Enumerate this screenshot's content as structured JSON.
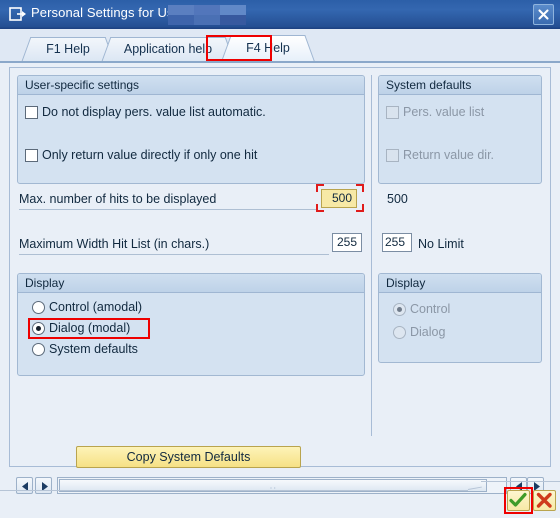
{
  "window": {
    "title": "Personal Settings for User",
    "title_icon": "dialog-window-icon",
    "username_redacted": "",
    "close_icon": "close-icon"
  },
  "tabs": [
    {
      "label": "F1 Help",
      "active": false
    },
    {
      "label": "Application help",
      "active": false
    },
    {
      "label": "F4 Help",
      "active": true,
      "highlighted": true
    }
  ],
  "user_settings": {
    "group_title": "User-specific settings",
    "checkboxes": [
      {
        "label": "Do not display pers. value list automatic.",
        "checked": false
      },
      {
        "label": "Only return value directly if only one hit",
        "checked": false
      }
    ],
    "fields": [
      {
        "label": "Max. number of hits to be displayed",
        "value": "500",
        "focused": true
      },
      {
        "label": "Maximum Width Hit List (in chars.)",
        "value": "255",
        "focused": false
      }
    ],
    "display_group": {
      "title": "Display",
      "options": [
        {
          "label": "Control (amodal)",
          "selected": false,
          "highlighted": false
        },
        {
          "label": "Dialog (modal)",
          "selected": true,
          "highlighted": true
        },
        {
          "label": "System defaults",
          "selected": false,
          "highlighted": false
        }
      ]
    }
  },
  "system_defaults": {
    "group_title": "System defaults",
    "checkboxes": [
      {
        "label": "Pers. value list",
        "checked": false,
        "disabled": true
      },
      {
        "label": "Return value dir.",
        "checked": false,
        "disabled": true
      }
    ],
    "max_hits_value": "500",
    "width_value": "255",
    "width_note": "No Limit",
    "display_group": {
      "title": "Display",
      "options": [
        {
          "label": "Control",
          "selected": true,
          "disabled": true
        },
        {
          "label": "Dialog",
          "selected": false,
          "disabled": true
        }
      ]
    }
  },
  "actions": {
    "copy_defaults_label": "Copy System Defaults",
    "ok_icon": "check-icon",
    "cancel_icon": "cross-icon",
    "ok_highlighted": true
  },
  "scrollbar": {
    "left_arrow_icon": "arrow-left-icon",
    "right_arrow_icon": "arrow-right-icon",
    "grip": "∷"
  },
  "colors": {
    "titlebar": "#2c5fa8",
    "panel": "#d4e2f1",
    "content": "#e9eff7",
    "highlight_red": "#ee0000",
    "focus_yellow": "#f7e9a6",
    "button_yellow": "#f6e185"
  }
}
